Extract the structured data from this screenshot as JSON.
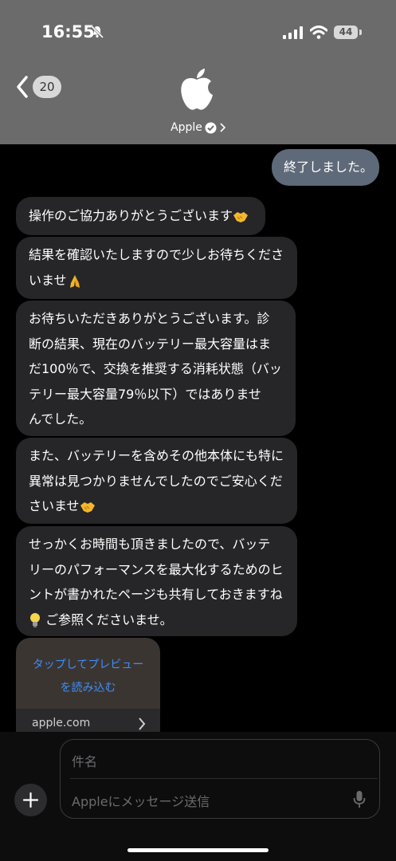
{
  "status_bar": {
    "time": "16:55",
    "battery": "44"
  },
  "header": {
    "back_count": "20",
    "contact_name": "Apple"
  },
  "messages": {
    "outgoing_1": "終了しました。",
    "in_1": "操作のご協力ありがとうございます",
    "in_2_line1": "結果を確認いたしますので少しお待ちくださ",
    "in_2_line2": "いませ",
    "in_3_line1": "お待ちいただきありがとうございます。診",
    "in_3_line2": "断の結果、現在のバッテリー最大容量はま",
    "in_3_line3": "だ100％で、交換を推奨する消耗状態（バッ",
    "in_3_line4": "テリー最大容量79％以下）ではありませ",
    "in_3_line5": "んでした。",
    "in_4_line1": "また、バッテリーを含めその他本体にも特に",
    "in_4_line2": "異常は見つかりませんでしたのでご安心くだ",
    "in_4_line3": "さいませ",
    "in_5_line1": "せっかくお時間も頂きましたので、バッテ",
    "in_5_line2": "リーのパフォーマンスを最大化するためのヒ",
    "in_5_line3": "ントが書かれたページも共有しておきますね",
    "in_5_line4": "ご参照くださいませ。"
  },
  "link_preview": {
    "line1": "タップしてプレビュー",
    "line2": "を読み込む",
    "domain": "apple.com"
  },
  "composer": {
    "subject_placeholder": "件名",
    "message_placeholder": "Appleにメッセージ送信"
  },
  "colors": {
    "header_bg": "#6b6b6b",
    "incoming_bubble": "#262628",
    "outgoing_bubble": "#5e6a79",
    "link_blue": "#3e8ef7"
  },
  "icons": [
    "mute-icon",
    "signal-icon",
    "wifi-icon",
    "battery-icon",
    "back-chevron-icon",
    "apple-logo-icon",
    "verified-badge-icon",
    "chevron-right-icon",
    "handshake-emoji",
    "pray-emoji",
    "lightbulb-emoji",
    "plus-icon",
    "mic-icon"
  ]
}
